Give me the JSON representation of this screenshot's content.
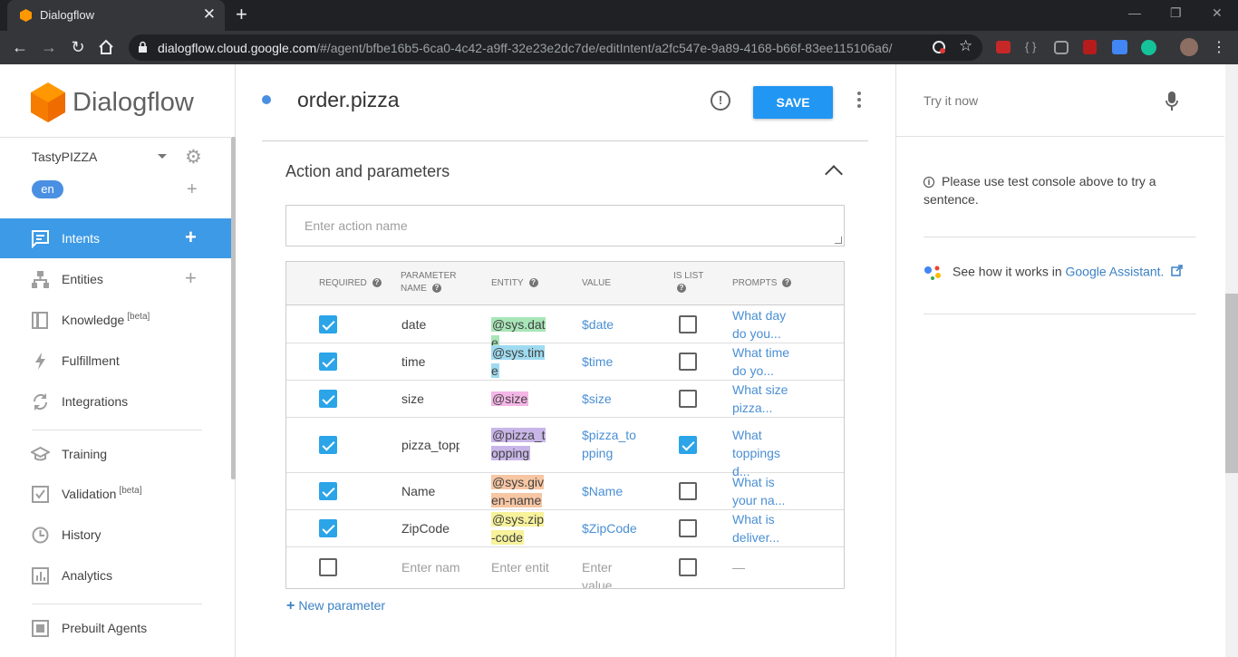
{
  "browser": {
    "tab_title": "Dialogflow",
    "url_domain": "dialogflow.cloud.google.com",
    "url_path": "/#/agent/bfbe16b5-6ca0-4c42-a9ff-32e23e2dc7de/editIntent/a2fc547e-9a89-4168-b66f-83ee115106a6/"
  },
  "sidebar": {
    "logo_text": "Dialogflow",
    "agent_name": "TastyPIZZA",
    "language": "en",
    "items": [
      {
        "label": "Intents",
        "icon": "chat-bubble-icon",
        "active": true
      },
      {
        "label": "Entities",
        "icon": "sitemap-icon"
      },
      {
        "label": "Knowledge",
        "sup": "[beta]",
        "icon": "book-icon"
      },
      {
        "label": "Fulfillment",
        "icon": "lightning-icon"
      },
      {
        "label": "Integrations",
        "icon": "sync-icon"
      },
      {
        "label": "Training",
        "icon": "graduation-cap-icon"
      },
      {
        "label": "Validation",
        "sup": "[beta]",
        "icon": "check-box-icon"
      },
      {
        "label": "History",
        "icon": "clock-icon"
      },
      {
        "label": "Analytics",
        "icon": "bar-chart-icon"
      },
      {
        "label": "Prebuilt Agents",
        "icon": "agents-icon"
      }
    ]
  },
  "editor": {
    "intent_name": "order.pizza",
    "save_label": "SAVE",
    "section_title": "Action and parameters",
    "action_placeholder": "Enter action name",
    "headers": {
      "required": "REQUIRED",
      "param_name_1": "PARAMETER",
      "param_name_2": "NAME",
      "entity": "ENTITY",
      "value": "VALUE",
      "is_list_1": "IS LIST",
      "prompts": "PROMPTS"
    },
    "rows": [
      {
        "required": true,
        "name": "date",
        "entity": "@sys.date",
        "value": "$date",
        "is_list": false,
        "prompt": "What day do you...",
        "entity_color": "#a8e6b8"
      },
      {
        "required": true,
        "name": "time",
        "entity": "@sys.time",
        "value": "$time",
        "is_list": false,
        "prompt": "What time do yo...",
        "entity_color": "#9fdbf0"
      },
      {
        "required": true,
        "name": "size",
        "entity": "@size",
        "value": "$size",
        "is_list": false,
        "prompt": "What size pizza...",
        "entity_color": "#f4b6e6"
      },
      {
        "required": true,
        "name": "pizza_topping",
        "entity": "@pizza_topping",
        "value": "$pizza_topping",
        "is_list": true,
        "prompt": "What toppings d...",
        "entity_color": "#c9b6e8"
      },
      {
        "required": true,
        "name": "Name",
        "entity": "@sys.given-name",
        "value": "$Name",
        "is_list": false,
        "prompt": "What is your na...",
        "entity_color": "#f7c6a3"
      },
      {
        "required": true,
        "name": "ZipCode",
        "entity": "@sys.zip-code",
        "value": "$ZipCode",
        "is_list": false,
        "prompt": "What is deliver...",
        "entity_color": "#f7f29b"
      }
    ],
    "empty_row": {
      "name_placeholder": "Enter name",
      "entity_placeholder": "Enter entity",
      "value_placeholder": "Enter value",
      "prompt_placeholder": "—"
    },
    "new_param_label": "New parameter"
  },
  "test_panel": {
    "placeholder": "Try it now",
    "info_text": "Please use test console above to try a sentence.",
    "ga_text": "See how it works in ",
    "ga_link": "Google Assistant."
  }
}
